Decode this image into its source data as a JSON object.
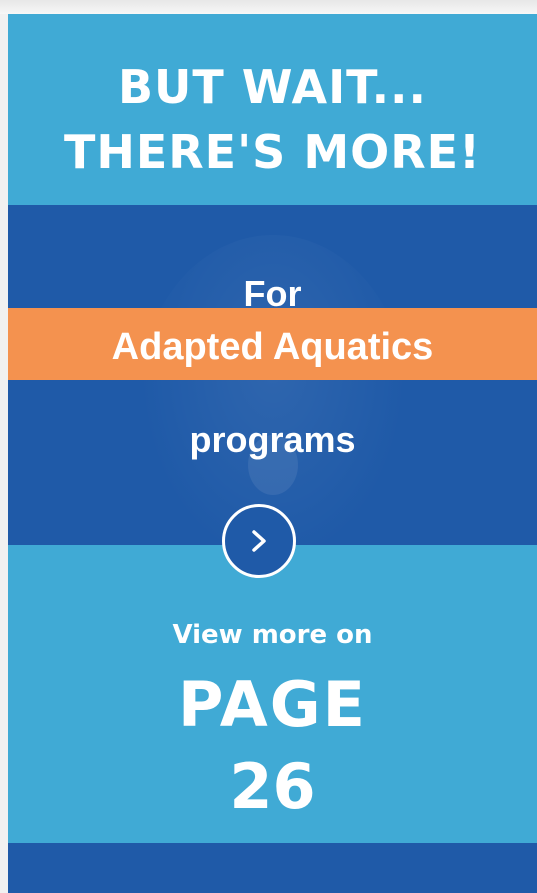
{
  "promo": {
    "headline_line1": "BUT WAIT...",
    "headline_line2": "THERE'S MORE!",
    "for_text": "For",
    "highlight_text": "Adapted Aquatics",
    "programs_text": "programs",
    "next_icon": "chevron-right-icon",
    "view_more_text": "View more on",
    "page_word": "PAGE",
    "page_number": "26"
  },
  "colors": {
    "light_blue": "#40aad5",
    "dark_blue": "#1f5aa8",
    "orange": "#f4924f",
    "text": "#ffffff"
  }
}
